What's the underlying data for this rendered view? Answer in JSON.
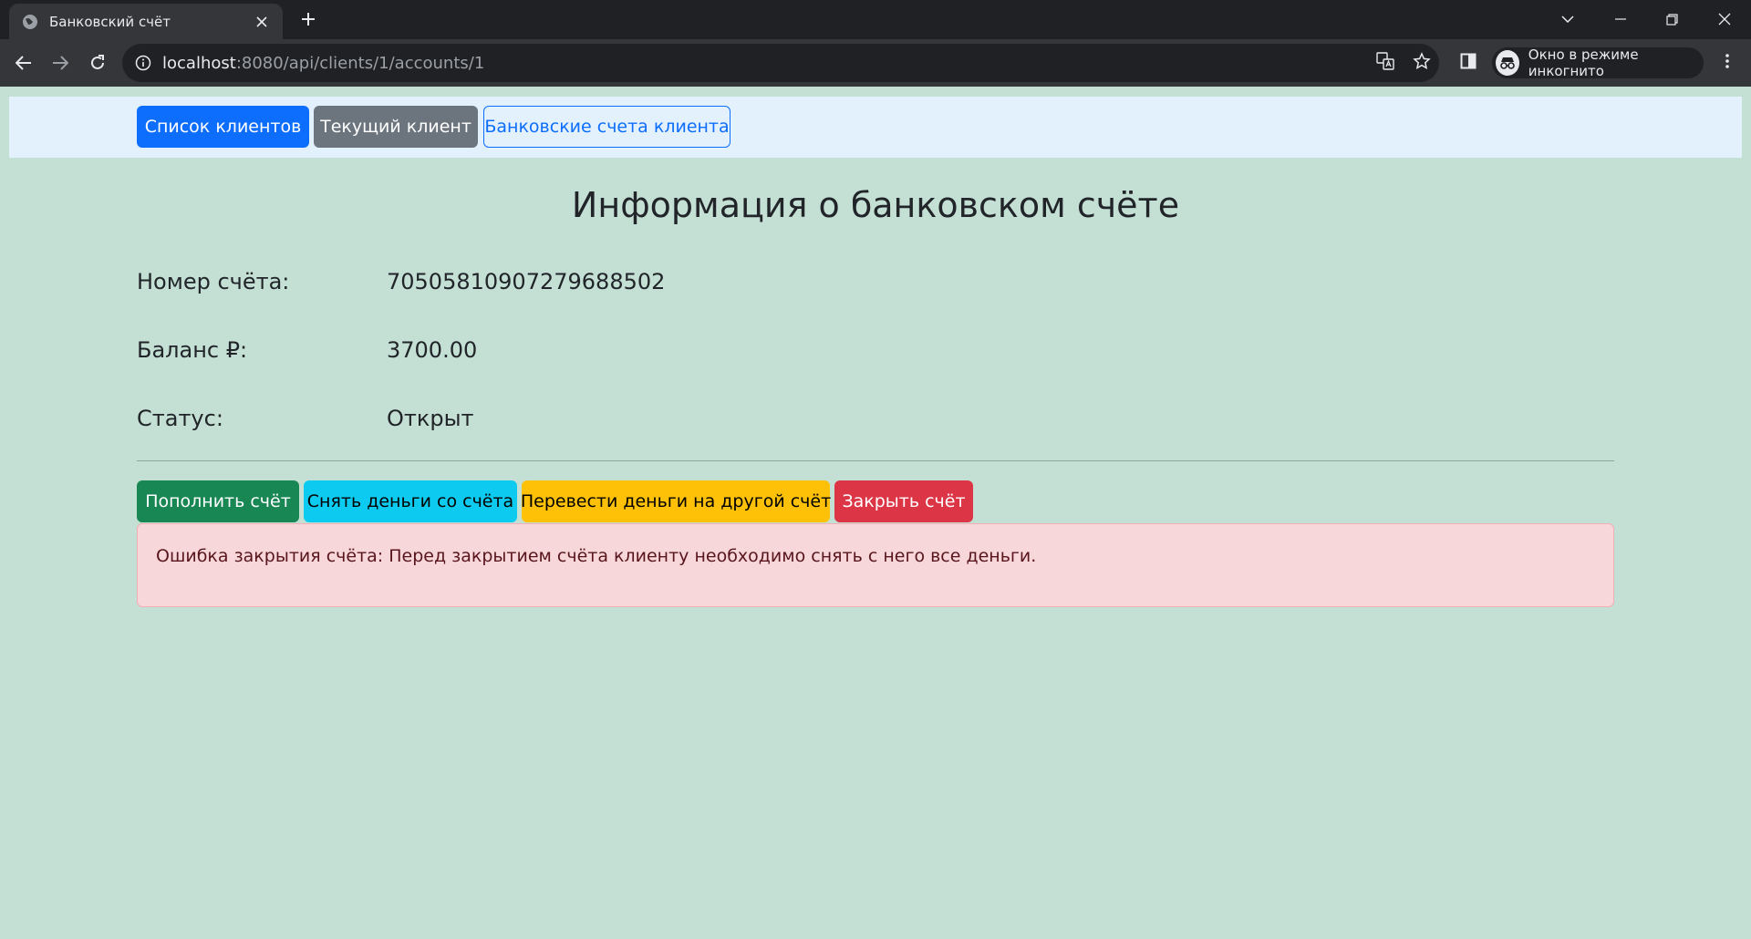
{
  "browser": {
    "tab_title": "Банковский счёт",
    "url_host": "localhost",
    "url_rest": ":8080/api/clients/1/accounts/1",
    "incognito_label": "Окно в режиме инкогнито"
  },
  "nav": {
    "clients_list": "Список клиентов",
    "current_client": "Текущий клиент",
    "client_accounts": "Банковские счета клиента"
  },
  "main": {
    "heading": "Информация о банковском счёте",
    "fields": [
      {
        "label": "Номер счёта:",
        "value": "70505810907279688502"
      },
      {
        "label": "Баланс ₽:",
        "value": "3700.00"
      },
      {
        "label": "Статус:",
        "value": "Открыт"
      }
    ]
  },
  "actions": {
    "deposit": "Пополнить счёт",
    "withdraw": "Снять деньги со счёта",
    "transfer": "Перевести деньги на другой счёт",
    "close": "Закрыть счёт"
  },
  "alert": {
    "message": "Ошибка закрытия счёта: Перед закрытием счёта клиенту необходимо снять с него все деньги."
  },
  "colors": {
    "page_bg": "#c4e0d4",
    "navbar_bg": "#e2f1fb",
    "primary": "#0d6efd",
    "secondary": "#6c757d",
    "success": "#198754",
    "info": "#0dcaf0",
    "warning": "#ffc107",
    "danger": "#dc3545"
  }
}
